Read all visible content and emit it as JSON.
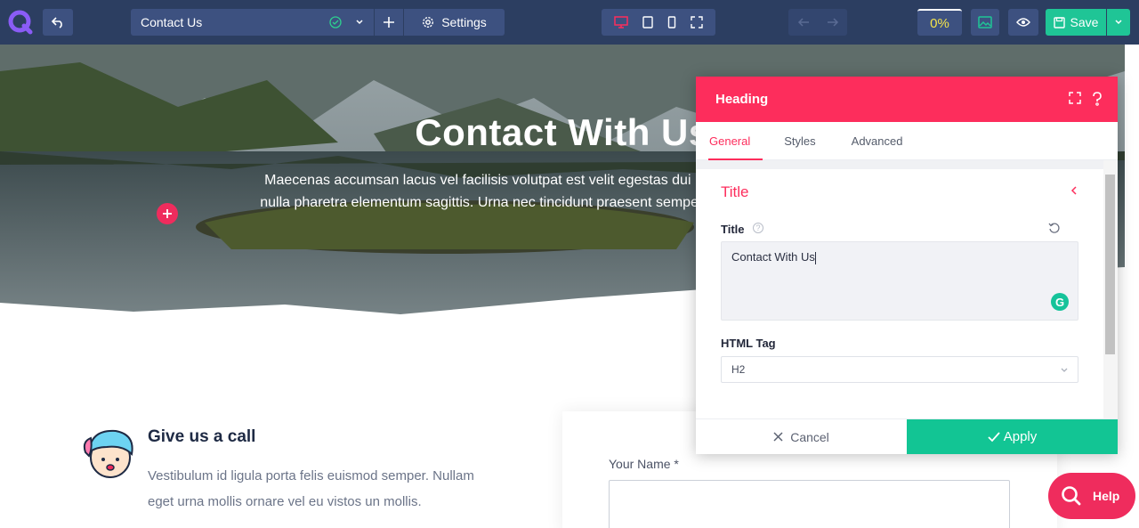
{
  "toolbar": {
    "page_name": "Contact Us",
    "settings_label": "Settings",
    "progress": "0%",
    "save_label": "Save"
  },
  "hero": {
    "title": "Contact With Us",
    "subtitle": "Maecenas accumsan lacus vel facilisis volutpat est velit egestas dui id ornare arcu odio ut sem nulla pharetra elementum sagittis. Urna nec tincidunt praesent semper feugiat nibh sed pulvinar."
  },
  "call": {
    "title": "Give us a call",
    "text": "Vestibulum id ligula porta felis euismod semper. Nullam eget urna mollis ornare vel eu vistos un mollis."
  },
  "form": {
    "name_label": "Your Name *"
  },
  "panel": {
    "title": "Heading",
    "tabs": [
      "General",
      "Styles",
      "Advanced"
    ],
    "section_title": "Title",
    "title_label": "Title",
    "title_value": "Contact With Us",
    "html_tag_label": "HTML Tag",
    "html_tag_value": "H2",
    "cancel_label": "Cancel",
    "apply_label": "Apply"
  },
  "help": {
    "label": "Help"
  },
  "colors": {
    "toolbar_bg": "#2c3e61",
    "accent": "#fd2d5c",
    "success": "#12c594",
    "progress_text": "#f5e44b"
  }
}
